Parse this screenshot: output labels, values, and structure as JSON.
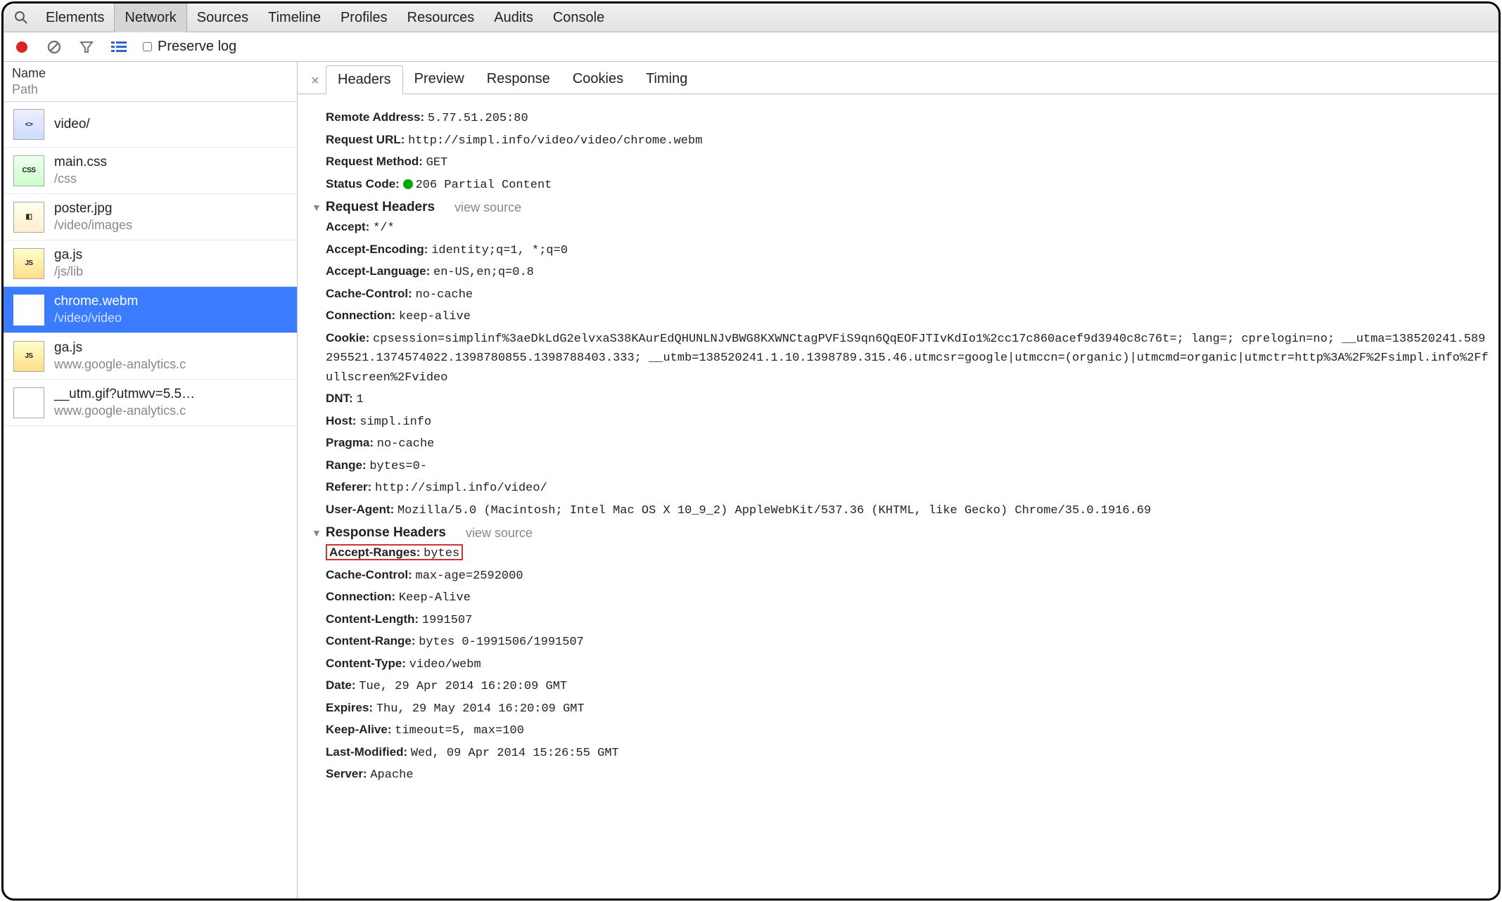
{
  "tabs": {
    "items": [
      "Elements",
      "Network",
      "Sources",
      "Timeline",
      "Profiles",
      "Resources",
      "Audits",
      "Console"
    ],
    "active": 1
  },
  "toolbar": {
    "preserve_label": "Preserve log"
  },
  "sidebar": {
    "col_name": "Name",
    "col_path": "Path",
    "items": [
      {
        "name": "video/",
        "path": "",
        "type": "html"
      },
      {
        "name": "main.css",
        "path": "/css",
        "type": "css"
      },
      {
        "name": "poster.jpg",
        "path": "/video/images",
        "type": "img"
      },
      {
        "name": "ga.js",
        "path": "/js/lib",
        "type": "js"
      },
      {
        "name": "chrome.webm",
        "path": "/video/video",
        "type": "vid",
        "selected": true
      },
      {
        "name": "ga.js",
        "path": "www.google-analytics.c",
        "type": "js"
      },
      {
        "name": "__utm.gif?utmwv=5.5…",
        "path": "www.google-analytics.c",
        "type": "gif"
      }
    ]
  },
  "detail_tabs": {
    "items": [
      "Headers",
      "Preview",
      "Response",
      "Cookies",
      "Timing"
    ],
    "active": 0
  },
  "general": {
    "remote_address_k": "Remote Address:",
    "remote_address_v": "5.77.51.205:80",
    "request_url_k": "Request URL:",
    "request_url_v": "http://simpl.info/video/video/chrome.webm",
    "request_method_k": "Request Method:",
    "request_method_v": "GET",
    "status_code_k": "Status Code:",
    "status_code_v": "206 Partial Content"
  },
  "req_hdr_title": "Request Headers",
  "view_source": "view source",
  "req": {
    "accept_k": "Accept:",
    "accept_v": "*/*",
    "accept_encoding_k": "Accept-Encoding:",
    "accept_encoding_v": "identity;q=1, *;q=0",
    "accept_language_k": "Accept-Language:",
    "accept_language_v": "en-US,en;q=0.8",
    "cache_control_k": "Cache-Control:",
    "cache_control_v": "no-cache",
    "connection_k": "Connection:",
    "connection_v": "keep-alive",
    "cookie_k": "Cookie:",
    "cookie_v": "cpsession=simplinf%3aeDkLdG2elvxaS38KAurEdQHUNLNJvBWG8KXWNCtagPVFiS9qn6QqEOFJTIvKdIo1%2cc17c860acef9d3940c8c76t=; lang=; cprelogin=no; __utma=138520241.589295521.1374574022.1398780855.1398788403.333; __utmb=138520241.1.10.1398789.315.46.utmcsr=google|utmccn=(organic)|utmcmd=organic|utmctr=http%3A%2F%2Fsimpl.info%2Ffullscreen%2Fvideo",
    "dnt_k": "DNT:",
    "dnt_v": "1",
    "host_k": "Host:",
    "host_v": "simpl.info",
    "pragma_k": "Pragma:",
    "pragma_v": "no-cache",
    "range_k": "Range:",
    "range_v": "bytes=0-",
    "referer_k": "Referer:",
    "referer_v": "http://simpl.info/video/",
    "user_agent_k": "User-Agent:",
    "user_agent_v": "Mozilla/5.0 (Macintosh; Intel Mac OS X 10_9_2) AppleWebKit/537.36 (KHTML, like Gecko) Chrome/35.0.1916.69"
  },
  "res_hdr_title": "Response Headers",
  "res": {
    "accept_ranges_k": "Accept-Ranges:",
    "accept_ranges_v": "bytes",
    "cache_control_k": "Cache-Control:",
    "cache_control_v": "max-age=2592000",
    "connection_k": "Connection:",
    "connection_v": "Keep-Alive",
    "content_length_k": "Content-Length:",
    "content_length_v": "1991507",
    "content_range_k": "Content-Range:",
    "content_range_v": "bytes 0-1991506/1991507",
    "content_type_k": "Content-Type:",
    "content_type_v": "video/webm",
    "date_k": "Date:",
    "date_v": "Tue, 29 Apr 2014 16:20:09 GMT",
    "expires_k": "Expires:",
    "expires_v": "Thu, 29 May 2014 16:20:09 GMT",
    "keep_alive_k": "Keep-Alive:",
    "keep_alive_v": "timeout=5, max=100",
    "last_modified_k": "Last-Modified:",
    "last_modified_v": "Wed, 09 Apr 2014 15:26:55 GMT",
    "server_k": "Server:",
    "server_v": "Apache"
  }
}
